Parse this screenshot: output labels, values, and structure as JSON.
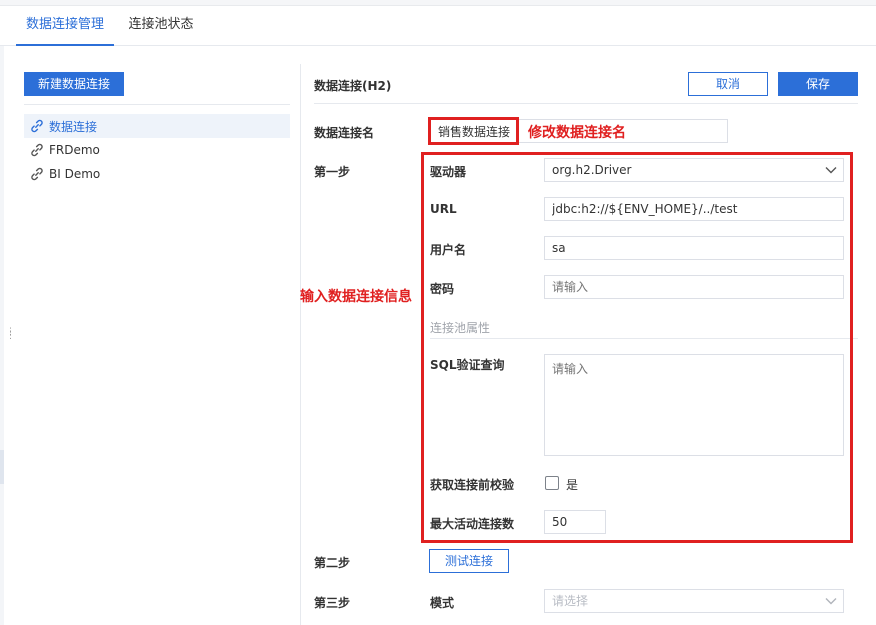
{
  "tabs": [
    {
      "label": "数据连接管理",
      "active": true
    },
    {
      "label": "连接池状态",
      "active": false
    }
  ],
  "sidebar": {
    "new_button": "新建数据连接",
    "items": [
      {
        "label": "数据连接",
        "selected": true,
        "icon": "link-icon"
      },
      {
        "label": "FRDemo",
        "selected": false,
        "icon": "link-icon"
      },
      {
        "label": "BI Demo",
        "selected": false,
        "icon": "link-icon"
      }
    ]
  },
  "form": {
    "title": "数据连接(H2)",
    "cancel_label": "取消",
    "save_label": "保存",
    "name_label": "数据连接名",
    "name_value": "销售数据连接",
    "step1_label": "第一步",
    "driver_label": "驱动器",
    "driver_value": "org.h2.Driver",
    "url_label": "URL",
    "url_value": "jdbc:h2://${ENV_HOME}/../test",
    "username_label": "用户名",
    "username_value": "sa",
    "password_label": "密码",
    "password_placeholder": "请输入",
    "pool_section_label": "连接池属性",
    "sql_label": "SQL验证查询",
    "sql_placeholder": "请输入",
    "validate_label": "获取连接前校验",
    "validate_option": "是",
    "validate_checked": false,
    "max_active_label": "最大活动连接数",
    "max_active_value": "50",
    "step2_label": "第二步",
    "test_button": "测试连接",
    "step3_label": "第三步",
    "mode_label": "模式",
    "mode_placeholder": "请选择"
  },
  "annotations": {
    "rename_note": "修改数据连接名",
    "info_note": "输入数据连接信息",
    "color": "#e02020"
  },
  "colors": {
    "accent": "#2c6fd8",
    "annotation_red": "#e02020"
  }
}
